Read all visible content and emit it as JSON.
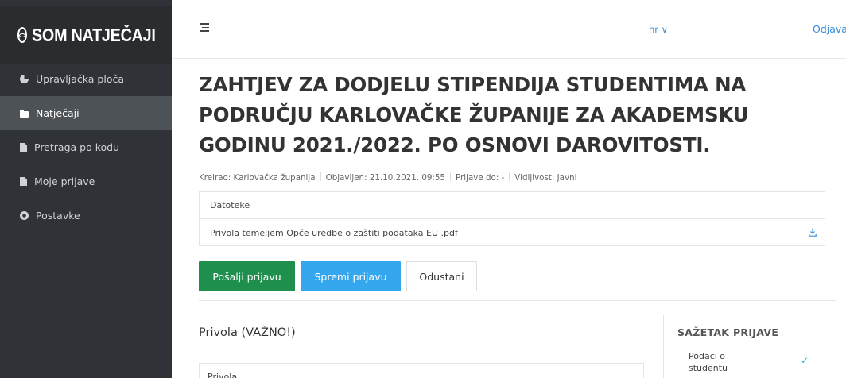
{
  "brand": {
    "name": "SOM NATJEČAJI",
    "logo_icon": "eye-logo-icon"
  },
  "sidebar": {
    "items": [
      {
        "label": "Upravljačka ploča",
        "icon": "dashboard-icon",
        "active": false
      },
      {
        "label": "Natječaji",
        "icon": "folder-icon",
        "active": true
      },
      {
        "label": "Pretraga po kodu",
        "icon": "file-icon",
        "active": false
      },
      {
        "label": "Moje prijave",
        "icon": "file-icon",
        "active": false
      },
      {
        "label": "Postavke",
        "icon": "gear-icon",
        "active": false
      }
    ]
  },
  "topbar": {
    "menu_icon": "menu-toggle-icon",
    "language": "hr ∨",
    "logout": "Odjava"
  },
  "main": {
    "title": "ZAHTJEV ZA DODJELU STIPENDIJA STUDENTIMA NA PODRUČJU KARLOVAČKE ŽUPANIJE ZA AKADEMSKU GODINU 2021./2022. PO OSNOVI DAROVITOSTI.",
    "meta": {
      "created": "Kreirao: Karlovačka županija",
      "published": "Objavljen: 21.10.2021. 09:55",
      "deadline": "Prijave do: -",
      "visibility": "Vidljivost: Javni"
    },
    "files": {
      "header": "Datoteke",
      "items": [
        {
          "name": "Privola temeljem Opće uredbe o zaštiti podataka EU .pdf"
        }
      ]
    },
    "buttons": {
      "send": "Pošalji prijavu",
      "save": "Spremi prijavu",
      "cancel": "Odustani"
    },
    "section": {
      "title": "Privola (VAŽNO!)",
      "card_label": "Privola"
    },
    "summary": {
      "title": "SAŽETAK PRIJAVE",
      "items": [
        {
          "label": "Podaci o studentu",
          "status": "✓"
        }
      ]
    }
  },
  "colors": {
    "sidebar_bg": "#2f3236",
    "sidebar_active": "#4d5257",
    "send_button": "#1e8f4c",
    "save_button": "#35a7ef",
    "link": "#3a8fd6"
  }
}
